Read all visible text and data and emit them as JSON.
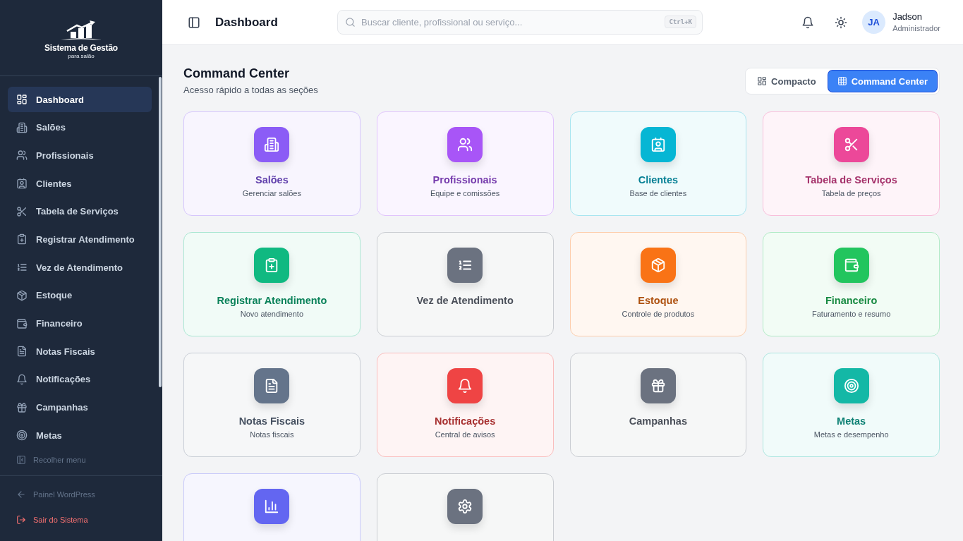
{
  "sidebar": {
    "logo": {
      "title": "Sistema de Gestão",
      "subtitle": "para salão"
    },
    "items": [
      {
        "label": "Dashboard",
        "selected": true
      },
      {
        "label": "Salões",
        "selected": false
      },
      {
        "label": "Profissionais",
        "selected": false
      },
      {
        "label": "Clientes",
        "selected": false
      },
      {
        "label": "Tabela de Serviços",
        "selected": false
      },
      {
        "label": "Registrar Atendimento",
        "selected": false
      },
      {
        "label": "Vez de Atendimento",
        "selected": false
      },
      {
        "label": "Estoque",
        "selected": false
      },
      {
        "label": "Financeiro",
        "selected": false
      },
      {
        "label": "Notas Fiscais",
        "selected": false
      },
      {
        "label": "Notificações",
        "selected": false
      },
      {
        "label": "Campanhas",
        "selected": false
      },
      {
        "label": "Metas",
        "selected": false
      }
    ],
    "collapse": "Recolher menu",
    "footer_links": [
      {
        "label": "Painel WordPress",
        "kind": "muted"
      },
      {
        "label": "Sair do Sistema",
        "kind": "danger"
      }
    ]
  },
  "header": {
    "title": "Dashboard",
    "search": {
      "placeholder": "Buscar cliente, profissional ou serviço...",
      "shortcut": "Ctrl+K"
    },
    "user": {
      "initials": "JA",
      "name": "Jadson",
      "role": "Administrador"
    }
  },
  "section": {
    "title": "Command Center",
    "subtitle": "Acesso rápido a todas as seções",
    "view_toggle": [
      {
        "label": "Compacto",
        "selected": false
      },
      {
        "label": "Command Center",
        "selected": true
      }
    ]
  },
  "cards": [
    {
      "title": "Salões",
      "subtitle": "Gerenciar salões",
      "color": "#8b5cf6"
    },
    {
      "title": "Profissionais",
      "subtitle": "Equipe e comissões",
      "color": "#a855f7"
    },
    {
      "title": "Clientes",
      "subtitle": "Base de clientes",
      "color": "#06b6d4"
    },
    {
      "title": "Tabela de Serviços",
      "subtitle": "Tabela de preços",
      "color": "#ec4899"
    },
    {
      "title": "Registrar Atendimento",
      "subtitle": "Novo atendimento",
      "color": "#10b981"
    },
    {
      "title": "Vez de Atendimento",
      "color": "#6b7280"
    },
    {
      "title": "Estoque",
      "subtitle": "Controle de produtos",
      "color": "#f97316"
    },
    {
      "title": "Financeiro",
      "subtitle": "Faturamento e resumo",
      "color": "#22c55e"
    },
    {
      "title": "Notas Fiscais",
      "subtitle": "Notas fiscais",
      "color": "#64748b"
    },
    {
      "title": "Notificações",
      "subtitle": "Central de avisos",
      "color": "#ef4444"
    },
    {
      "title": "Campanhas",
      "color": "#6b7280"
    },
    {
      "title": "Metas",
      "subtitle": "Metas e desempenho",
      "color": "#14b8a6"
    },
    {
      "color": "#6366f1"
    },
    {
      "color": "#6b7280"
    }
  ]
}
